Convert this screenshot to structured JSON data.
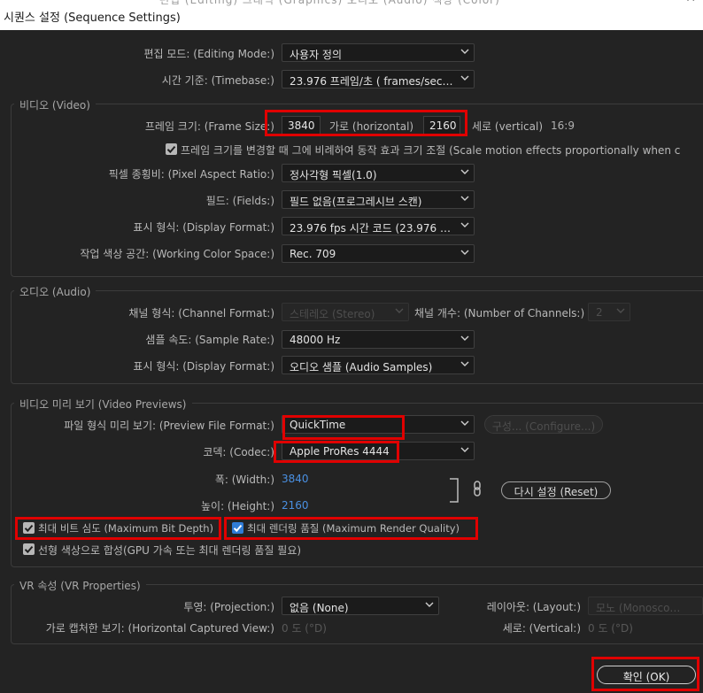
{
  "window": {
    "title": "시퀀스 설정 (Sequence Settings)",
    "background_tabs": "편집 (Editing)   그래픽 (Graphics)   오디오 (Audio)   색상 (Color)",
    "close_glyph": "✕"
  },
  "general": {
    "editing_mode_label": "편집 모드: (Editing Mode:)",
    "editing_mode_value": "사용자 정의",
    "timebase_label": "시간 기준: (Timebase:)",
    "timebase_value": "23.976  프레임/초 ( frames/seco..."
  },
  "video": {
    "section_title": "비디오 (Video)",
    "frame_size_label": "프레임 크기: (Frame Size:)",
    "frame_width": "3840",
    "horizontal_label": "가로 (horizontal)",
    "frame_height": "2160",
    "vertical_label": "세로 (vertical)",
    "aspect": "16:9",
    "scale_motion_label": "프레임 크기를 변경할 때 그에 비례하여 동작 효과 크기 조절 (Scale motion effects proportionally when c",
    "pixel_aspect_label": "픽셀 종횡비: (Pixel Aspect Ratio:)",
    "pixel_aspect_value": "정사각형 픽셀(1.0)",
    "fields_label": "필드: (Fields:)",
    "fields_value": "필드 없음(프로그레시브 스캔)",
    "display_format_label": "표시 형식: (Display Format:)",
    "display_format_value": "23.976 fps 시간 코드 (23.976 fps...",
    "color_space_label": "작업 색상 공간: (Working Color Space:)",
    "color_space_value": "Rec. 709"
  },
  "audio": {
    "section_title": "오디오 (Audio)",
    "channel_format_label": "채널 형식: (Channel Format:)",
    "channel_format_value": "스테레오 (Stereo)",
    "num_channels_label": "채널 개수: (Number of Channels:)",
    "num_channels_value": "2",
    "sample_rate_label": "샘플 속도: (Sample Rate:)",
    "sample_rate_value": "48000 Hz",
    "display_format_label": "표시 형식: (Display Format:)",
    "display_format_value": "오디오 샘플 (Audio Samples)"
  },
  "previews": {
    "section_title": "비디오 미리 보기 (Video Previews)",
    "file_format_label": "파일 형식 미리 보기: (Preview File Format:)",
    "file_format_value": "QuickTime",
    "configure_label": "구성... (Configure...)",
    "codec_label": "코덱: (Codec:)",
    "codec_value": "Apple ProRes 4444",
    "width_label": "폭: (Width:)",
    "width_value": "3840",
    "height_label": "높이: (Height:)",
    "height_value": "2160",
    "reset_label": "다시 설정 (Reset)"
  },
  "options": {
    "max_bit_depth_label": "최대 비트 심도 (Maximum Bit Depth)",
    "max_render_quality_label": "최대 렌더링 품질 (Maximum Render Quality)",
    "linear_color_label": "선형 색상으로 합성(GPU 가속 또는 최대 렌더링 품질 필요)"
  },
  "vr": {
    "section_title": "VR 속성 (VR Properties)",
    "projection_label": "투영: (Projection:)",
    "projection_value": "없음 (None)",
    "layout_label": "레이아웃: (Layout:)",
    "layout_value": "모노 (Monoscopic)",
    "horizontal_view_label": "가로 캡처한 보기: (Horizontal Captured View:)",
    "horizontal_view_value": "0 도 (°D)",
    "vertical_label": "세로: (Vertical:)",
    "vertical_value": "0 도 (°D)"
  },
  "footer": {
    "ok_label": "확인 (OK)"
  },
  "colors": {
    "highlight": "#e00000",
    "accent": "#4a90e2",
    "background": "#232323"
  }
}
